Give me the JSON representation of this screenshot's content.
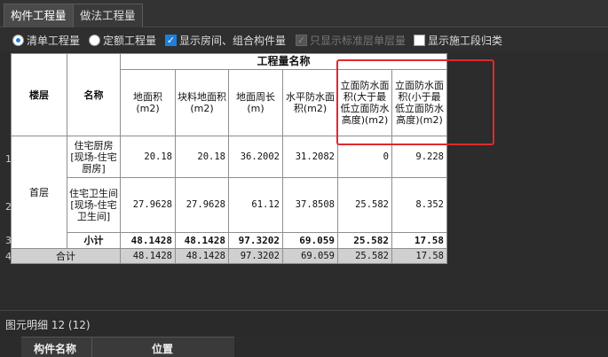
{
  "tabs": [
    {
      "label": "构件工程量",
      "active": true
    },
    {
      "label": "做法工程量",
      "active": false
    }
  ],
  "options": {
    "radio_bill": "清单工程量",
    "radio_quota": "定额工程量",
    "chk_show_rooms": "显示房间、组合构件量",
    "chk_std_floor": "只显示标准层单层量",
    "chk_stage": "显示施工段归类"
  },
  "table": {
    "group_header": "工程量名称",
    "col_floor": "楼层",
    "col_name": "名称",
    "columns": [
      "地面积(m2)",
      "块料地面积(m2)",
      "地面周长(m)",
      "水平防水面积(m2)",
      "立面防水面积(大于最低立面防水高度)(m2)",
      "立面防水面积(小于最低立面防水高度)(m2)"
    ],
    "floor": "首层",
    "rows": [
      {
        "num": "1",
        "name": "住宅厨房[现场-住宅厨房]",
        "values": [
          "20.18",
          "20.18",
          "36.2002",
          "31.2082",
          "0",
          "9.228"
        ]
      },
      {
        "num": "2",
        "name": "住宅卫生间[现场-住宅卫生间]",
        "values": [
          "27.9628",
          "27.9628",
          "61.12",
          "37.8508",
          "25.582",
          "8.352"
        ]
      }
    ],
    "subtotal": {
      "num": "3",
      "label": "小计",
      "values": [
        "48.1428",
        "48.1428",
        "97.3202",
        "69.059",
        "25.582",
        "17.58"
      ]
    },
    "total": {
      "num": "4",
      "label": "合计",
      "values": [
        "48.1428",
        "48.1428",
        "97.3202",
        "69.059",
        "25.582",
        "17.58"
      ]
    }
  },
  "detail": {
    "title": "图元明细  12 (12)",
    "col_component": "构件名称",
    "col_position": "位置"
  },
  "colors": {
    "highlight": "#e0292d",
    "accent": "#1f7fd6"
  }
}
